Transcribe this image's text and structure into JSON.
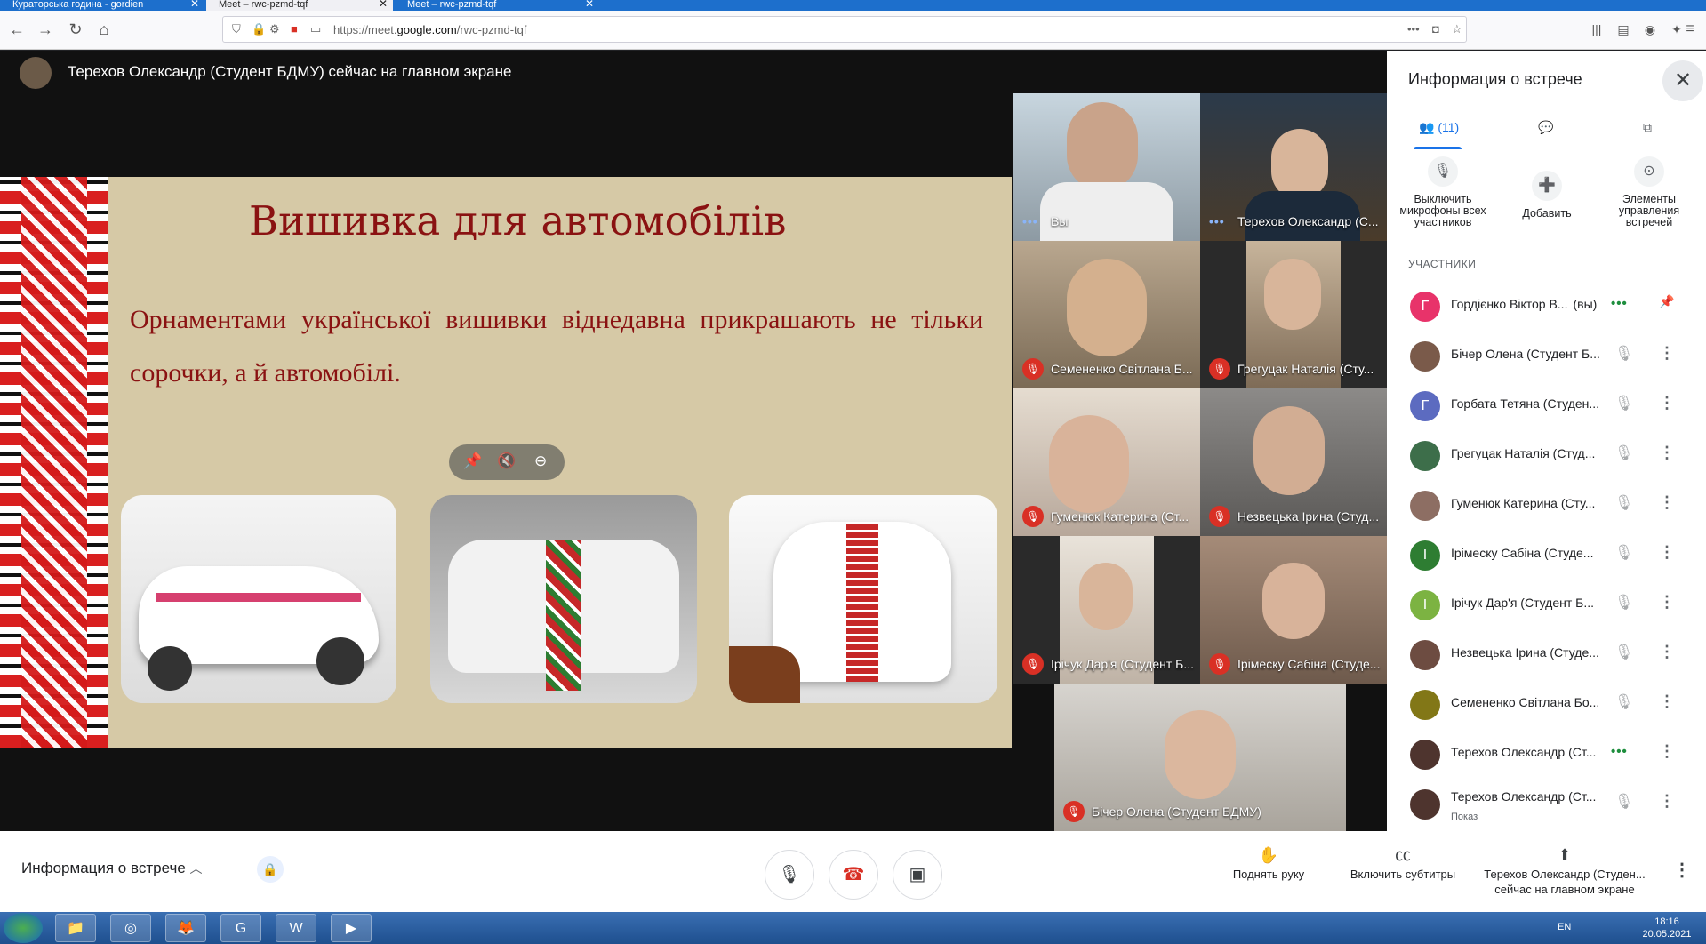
{
  "browser": {
    "tabs": [
      {
        "title": "Кураторська година - gordien",
        "active": false
      },
      {
        "title": "Meet – rwc-pzmd-tqf",
        "active": true
      },
      {
        "title": "Meet – rwc-pzmd-tqf",
        "active": false
      }
    ],
    "url_prefix": "https://meet.",
    "url_domain": "google.com",
    "url_path": "/rwc-pzmd-tqf"
  },
  "meet": {
    "presenter_banner": "Терехов Олександр (Студент БДМУ) сейчас на главном экране",
    "slide": {
      "title": "Вишивка для автомобілів",
      "text": "Орнаментами української вишивки віднедавна прикрашають не тільки сорочки, а й автомобілі."
    },
    "tiles": [
      {
        "name": "Вы",
        "muted": false
      },
      {
        "name": "Терехов Олександр (С...",
        "muted": false
      },
      {
        "name": "Семененко Світлана Б...",
        "muted": true
      },
      {
        "name": "Грегуцак Наталія (Сту...",
        "muted": true
      },
      {
        "name": "Гуменюк Катерина (Ст...",
        "muted": true
      },
      {
        "name": "Незвецька Ірина (Студ...",
        "muted": true
      },
      {
        "name": "Ірічук Дар'я (Студент Б...",
        "muted": true
      },
      {
        "name": "Ірімеску Сабіна (Студе...",
        "muted": true
      },
      {
        "name": "Бічер Олена (Студент БДМУ)",
        "muted": true
      }
    ]
  },
  "panel": {
    "title": "Информация о встрече",
    "participants_count": "(11)",
    "actions": {
      "mute_all": "Выключить микрофоны всех участников",
      "add": "Добавить",
      "controls": "Элементы управления встречей"
    },
    "section_label": "УЧАСТНИКИ",
    "participants": [
      {
        "name": "Гордієнко Віктор В...",
        "suffix": "(вы)",
        "initial": "Г",
        "color": "#e8336a"
      },
      {
        "name": "Бічер Олена (Студент Б...",
        "initial": "",
        "color": "#7a5a4a"
      },
      {
        "name": "Горбата Тетяна (Студен...",
        "initial": "Г",
        "color": "#5c6bc0"
      },
      {
        "name": "Грегуцак Наталія (Студ...",
        "initial": "",
        "color": "#3d6e4a"
      },
      {
        "name": "Гуменюк Катерина (Сту...",
        "initial": "",
        "color": "#8d6e63"
      },
      {
        "name": "Ірімеску Сабіна (Студе...",
        "initial": "І",
        "color": "#2e7d32"
      },
      {
        "name": "Ірічук Дар'я (Студент Б...",
        "initial": "І",
        "color": "#7cb342"
      },
      {
        "name": "Незвецька Ірина (Студе...",
        "initial": "",
        "color": "#6d4c41"
      },
      {
        "name": "Семененко Світлана Бо...",
        "initial": "",
        "color": "#827717"
      },
      {
        "name": "Терехов Олександр (Ст...",
        "initial": "",
        "color": "#4e342e"
      },
      {
        "name": "Терехов Олександр (Ст...",
        "sub": "Показ",
        "initial": "",
        "color": "#4e342e"
      }
    ]
  },
  "bottom": {
    "meeting_info": "Информация о встрече",
    "raise_hand": "Поднять руку",
    "captions": "Включить субтитры",
    "presenting_1": "Терехов Олександр (Студен...",
    "presenting_2": "сейчас на главном экране"
  },
  "taskbar": {
    "lang": "EN",
    "time": "18:16",
    "date": "20.05.2021"
  }
}
